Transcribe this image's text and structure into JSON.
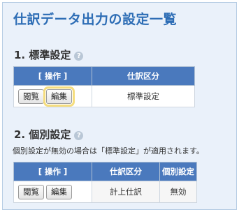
{
  "page": {
    "title": "仕訳データ出力の設定一覧"
  },
  "section1": {
    "title": "1. 標準設定",
    "headers": {
      "ops": "[ 操作 ]",
      "category": "仕訳区分"
    },
    "row": {
      "view": "閲覧",
      "edit": "編集",
      "category": "標準設定"
    }
  },
  "section2": {
    "title": "2. 個別設定",
    "note": "個別設定が無効の場合は「標準設定」が適用されます。",
    "headers": {
      "ops": "[ 操作 ]",
      "category": "仕訳区分",
      "setting": "個別設定"
    },
    "row": {
      "view": "閲覧",
      "edit": "編集",
      "category": "計上仕訳",
      "setting": "無効"
    }
  },
  "icons": {
    "help": "?"
  }
}
